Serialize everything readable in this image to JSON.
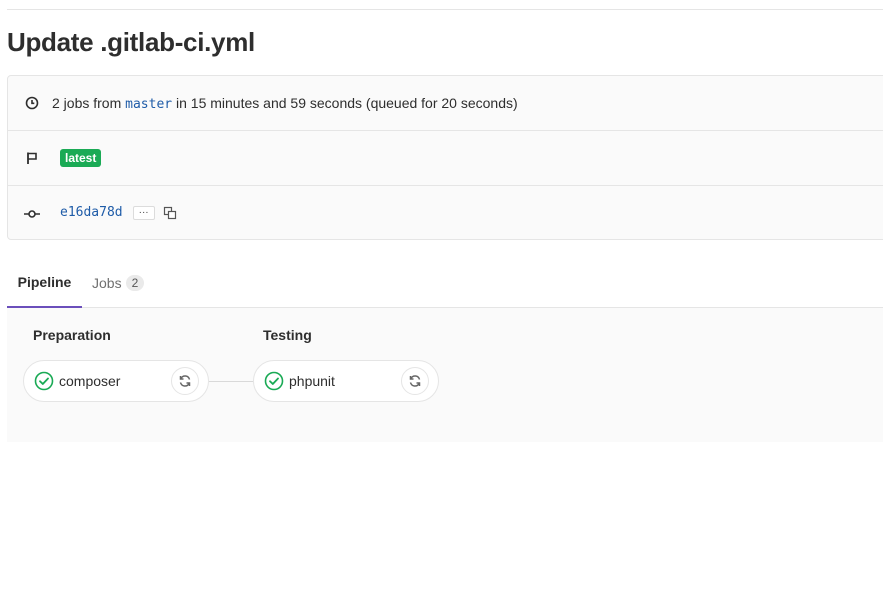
{
  "page": {
    "title": "Update .gitlab-ci.yml"
  },
  "info": {
    "jobs_prefix": "2 jobs from",
    "branch": "master",
    "duration_text": "in 15 minutes and 59 seconds (queued for 20 seconds)",
    "badge": "latest",
    "commit_sha": "e16da78d",
    "ellipsis": "···"
  },
  "tabs": [
    {
      "label": "Pipeline",
      "active": true
    },
    {
      "label": "Jobs",
      "count": "2",
      "active": false
    }
  ],
  "stages": [
    {
      "title": "Preparation",
      "jobs": [
        {
          "name": "composer",
          "status": "passed"
        }
      ]
    },
    {
      "title": "Testing",
      "jobs": [
        {
          "name": "phpunit",
          "status": "passed"
        }
      ]
    }
  ],
  "colors": {
    "success": "#1aaa55",
    "link": "#1f5ca8",
    "tab_active": "#6b4fbb"
  },
  "icons": {
    "duration": "clock-icon",
    "badge": "flag-icon",
    "commit": "commit-icon",
    "copy": "copy-icon",
    "status": "status-success-icon",
    "retry": "retry-icon"
  }
}
